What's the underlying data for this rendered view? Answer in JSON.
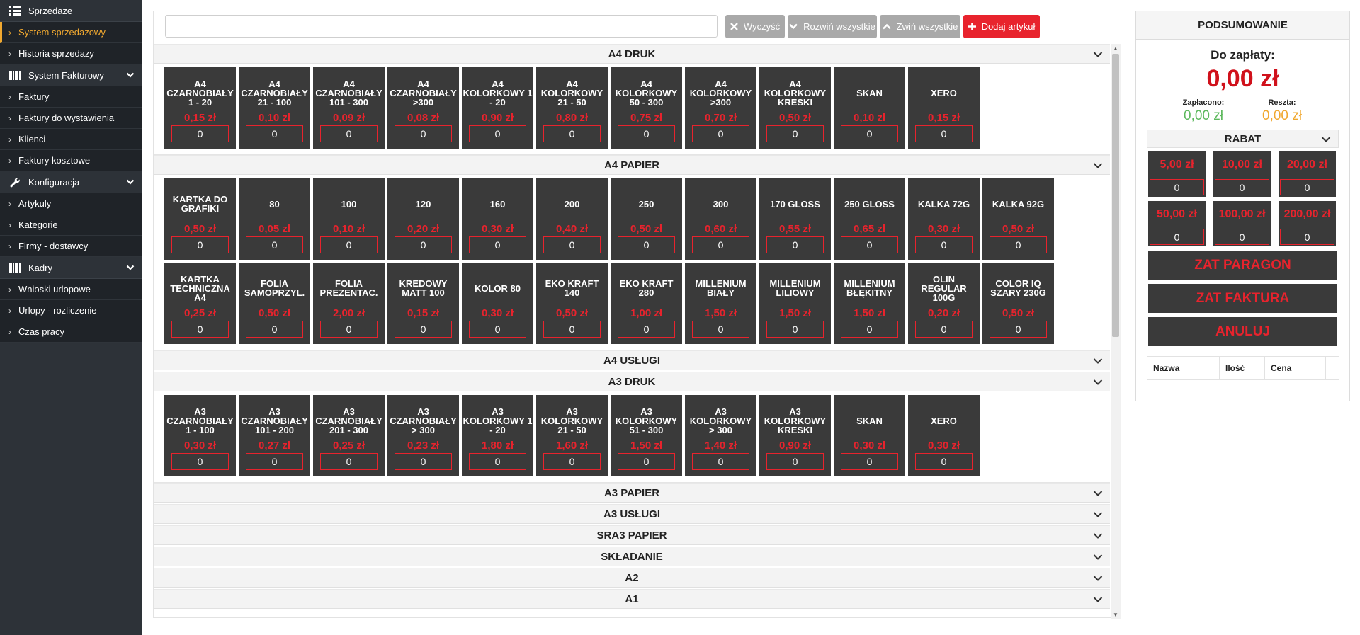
{
  "sidebar": {
    "sections": [
      {
        "label": "Sprzedaze",
        "icon": "list-icon",
        "has_chevron": false,
        "items": [
          {
            "label": "System sprzedazowy",
            "active": true
          },
          {
            "label": "Historia sprzedazy",
            "active": false
          }
        ]
      },
      {
        "label": "System Fakturowy",
        "icon": "barcode-icon",
        "has_chevron": true,
        "items": [
          {
            "label": "Faktury"
          },
          {
            "label": "Faktury do wystawienia"
          },
          {
            "label": "Klienci"
          },
          {
            "label": "Faktury kosztowe"
          }
        ]
      },
      {
        "label": "Konfiguracja",
        "icon": "wrench-icon",
        "has_chevron": true,
        "items": [
          {
            "label": "Artykuly"
          },
          {
            "label": "Kategorie"
          },
          {
            "label": "Firmy - dostawcy"
          }
        ]
      },
      {
        "label": "Kadry",
        "icon": "barcode-icon",
        "has_chevron": true,
        "items": [
          {
            "label": "Wnioski urlopowe"
          },
          {
            "label": "Urlopy - rozliczenie"
          },
          {
            "label": "Czas pracy"
          }
        ]
      }
    ]
  },
  "toolbar": {
    "search_value": "",
    "clear_label": "Wyczyść",
    "expand_label": "Rozwiń wszystkie",
    "collapse_label": "Zwiń wszystkie",
    "add_label": "Dodaj artykuł"
  },
  "panels": [
    {
      "title": "A4 DRUK",
      "open": true,
      "tiles": [
        {
          "name": "A4 CZARNOBIAŁY 1 - 20",
          "price": "0,15 zł",
          "qty": "0"
        },
        {
          "name": "A4 CZARNOBIAŁY 21 - 100",
          "price": "0,10 zł",
          "qty": "0"
        },
        {
          "name": "A4 CZARNOBIAŁY 101 - 300",
          "price": "0,09 zł",
          "qty": "0"
        },
        {
          "name": "A4 CZARNOBIAŁY >300",
          "price": "0,08 zł",
          "qty": "0"
        },
        {
          "name": "A4 KOLORKOWY 1 - 20",
          "price": "0,90 zł",
          "qty": "0"
        },
        {
          "name": "A4 KOLORKOWY 21 - 50",
          "price": "0,80 zł",
          "qty": "0"
        },
        {
          "name": "A4 KOLORKOWY 50 - 300",
          "price": "0,75 zł",
          "qty": "0"
        },
        {
          "name": "A4 KOLORKOWY >300",
          "price": "0,70 zł",
          "qty": "0"
        },
        {
          "name": "A4 KOLORKOWY KRESKI",
          "price": "0,50 zł",
          "qty": "0"
        },
        {
          "name": "SKAN",
          "price": "0,10 zł",
          "qty": "0"
        },
        {
          "name": "XERO",
          "price": "0,15 zł",
          "qty": "0"
        }
      ]
    },
    {
      "title": "A4 PAPIER",
      "open": true,
      "tiles": [
        {
          "name": "KARTKA DO GRAFIKI",
          "price": "0,50 zł",
          "qty": "0"
        },
        {
          "name": "80",
          "price": "0,05 zł",
          "qty": "0"
        },
        {
          "name": "100",
          "price": "0,10 zł",
          "qty": "0"
        },
        {
          "name": "120",
          "price": "0,20 zł",
          "qty": "0"
        },
        {
          "name": "160",
          "price": "0,30 zł",
          "qty": "0"
        },
        {
          "name": "200",
          "price": "0,40 zł",
          "qty": "0"
        },
        {
          "name": "250",
          "price": "0,50 zł",
          "qty": "0"
        },
        {
          "name": "300",
          "price": "0,60 zł",
          "qty": "0"
        },
        {
          "name": "170 GLOSS",
          "price": "0,55 zł",
          "qty": "0"
        },
        {
          "name": "250 GLOSS",
          "price": "0,65 zł",
          "qty": "0"
        },
        {
          "name": "KALKA 72G",
          "price": "0,30 zł",
          "qty": "0"
        },
        {
          "name": "KALKA 92G",
          "price": "0,50 zł",
          "qty": "0"
        },
        {
          "name": "KARTKA TECHNICZNA A4",
          "price": "0,25 zł",
          "qty": "0"
        },
        {
          "name": "FOLIA SAMOPRZYL.",
          "price": "0,50 zł",
          "qty": "0"
        },
        {
          "name": "FOLIA PREZENTAC.",
          "price": "2,00 zł",
          "qty": "0"
        },
        {
          "name": "KREDOWY MATT 100",
          "price": "0,15 zł",
          "qty": "0"
        },
        {
          "name": "KOLOR 80",
          "price": "0,30 zł",
          "qty": "0"
        },
        {
          "name": "EKO KRAFT 140",
          "price": "0,50 zł",
          "qty": "0"
        },
        {
          "name": "EKO KRAFT 280",
          "price": "1,00 zł",
          "qty": "0"
        },
        {
          "name": "MILLENIUM BIAŁY",
          "price": "1,50 zł",
          "qty": "0"
        },
        {
          "name": "MILLENIUM LILIOWY",
          "price": "1,50 zł",
          "qty": "0"
        },
        {
          "name": "MILLENIUM BŁĘKITNY",
          "price": "1,50 zł",
          "qty": "0"
        },
        {
          "name": "OLIN REGULAR 100G",
          "price": "0,20 zł",
          "qty": "0"
        },
        {
          "name": "COLOR IQ SZARY 230G",
          "price": "0,50 zł",
          "qty": "0"
        }
      ]
    },
    {
      "title": "A4 USŁUGI",
      "open": false,
      "tiles": []
    },
    {
      "title": "A3 DRUK",
      "open": true,
      "tiles": [
        {
          "name": "A3 CZARNOBIAŁY 1 - 100",
          "price": "0,30 zł",
          "qty": "0"
        },
        {
          "name": "A3 CZARNOBIAŁY 101 - 200",
          "price": "0,27 zł",
          "qty": "0"
        },
        {
          "name": "A3 CZARNOBIAŁY 201 - 300",
          "price": "0,25 zł",
          "qty": "0"
        },
        {
          "name": "A3 CZARNOBIAŁY > 300",
          "price": "0,23 zł",
          "qty": "0"
        },
        {
          "name": "A3 KOLORKOWY 1 - 20",
          "price": "1,80 zł",
          "qty": "0"
        },
        {
          "name": "A3 KOLORKOWY 21 - 50",
          "price": "1,60 zł",
          "qty": "0"
        },
        {
          "name": "A3 KOLORKOWY 51 - 300",
          "price": "1,50 zł",
          "qty": "0"
        },
        {
          "name": "A3 KOLORKOWY > 300",
          "price": "1,40 zł",
          "qty": "0"
        },
        {
          "name": "A3 KOLORKOWY KRESKI",
          "price": "0,90 zł",
          "qty": "0"
        },
        {
          "name": "SKAN",
          "price": "0,30 zł",
          "qty": "0"
        },
        {
          "name": "XERO",
          "price": "0,30 zł",
          "qty": "0"
        }
      ]
    },
    {
      "title": "A3 PAPIER",
      "open": false,
      "tiles": []
    },
    {
      "title": "A3 USŁUGI",
      "open": false,
      "tiles": []
    },
    {
      "title": "SRA3 PAPIER",
      "open": false,
      "tiles": []
    },
    {
      "title": "SKŁADANIE",
      "open": false,
      "tiles": []
    },
    {
      "title": "A2",
      "open": false,
      "tiles": []
    },
    {
      "title": "A1",
      "open": false,
      "tiles": []
    }
  ],
  "summary": {
    "title": "PODSUMOWANIE",
    "due_label": "Do zapłaty:",
    "due_value": "0,00 zł",
    "paid_label": "Zapłacono:",
    "paid_value": "0,00 zł",
    "change_label": "Reszta:",
    "change_value": "0,00 zł",
    "rabat_label": "RABAT",
    "rabat_tiles": [
      {
        "value": "5,00 zł",
        "qty": "0"
      },
      {
        "value": "10,00 zł",
        "qty": "0"
      },
      {
        "value": "20,00 zł",
        "qty": "0"
      },
      {
        "value": "50,00 zł",
        "qty": "0"
      },
      {
        "value": "100,00 zł",
        "qty": "0"
      },
      {
        "value": "200,00 zł",
        "qty": "0"
      }
    ],
    "btn_receipt": "ZAT PARAGON",
    "btn_invoice": "ZAT FAKTURA",
    "btn_cancel": "ANULUJ",
    "cart_headers": [
      "Nazwa",
      "Ilość",
      "Cena",
      ""
    ]
  },
  "colors": {
    "accent_red": "#e8232d",
    "active_orange": "#f0a830",
    "paid_green": "#5cb85c",
    "tile_bg": "#3a3a3a",
    "sidebar_bg": "#2d3238"
  }
}
